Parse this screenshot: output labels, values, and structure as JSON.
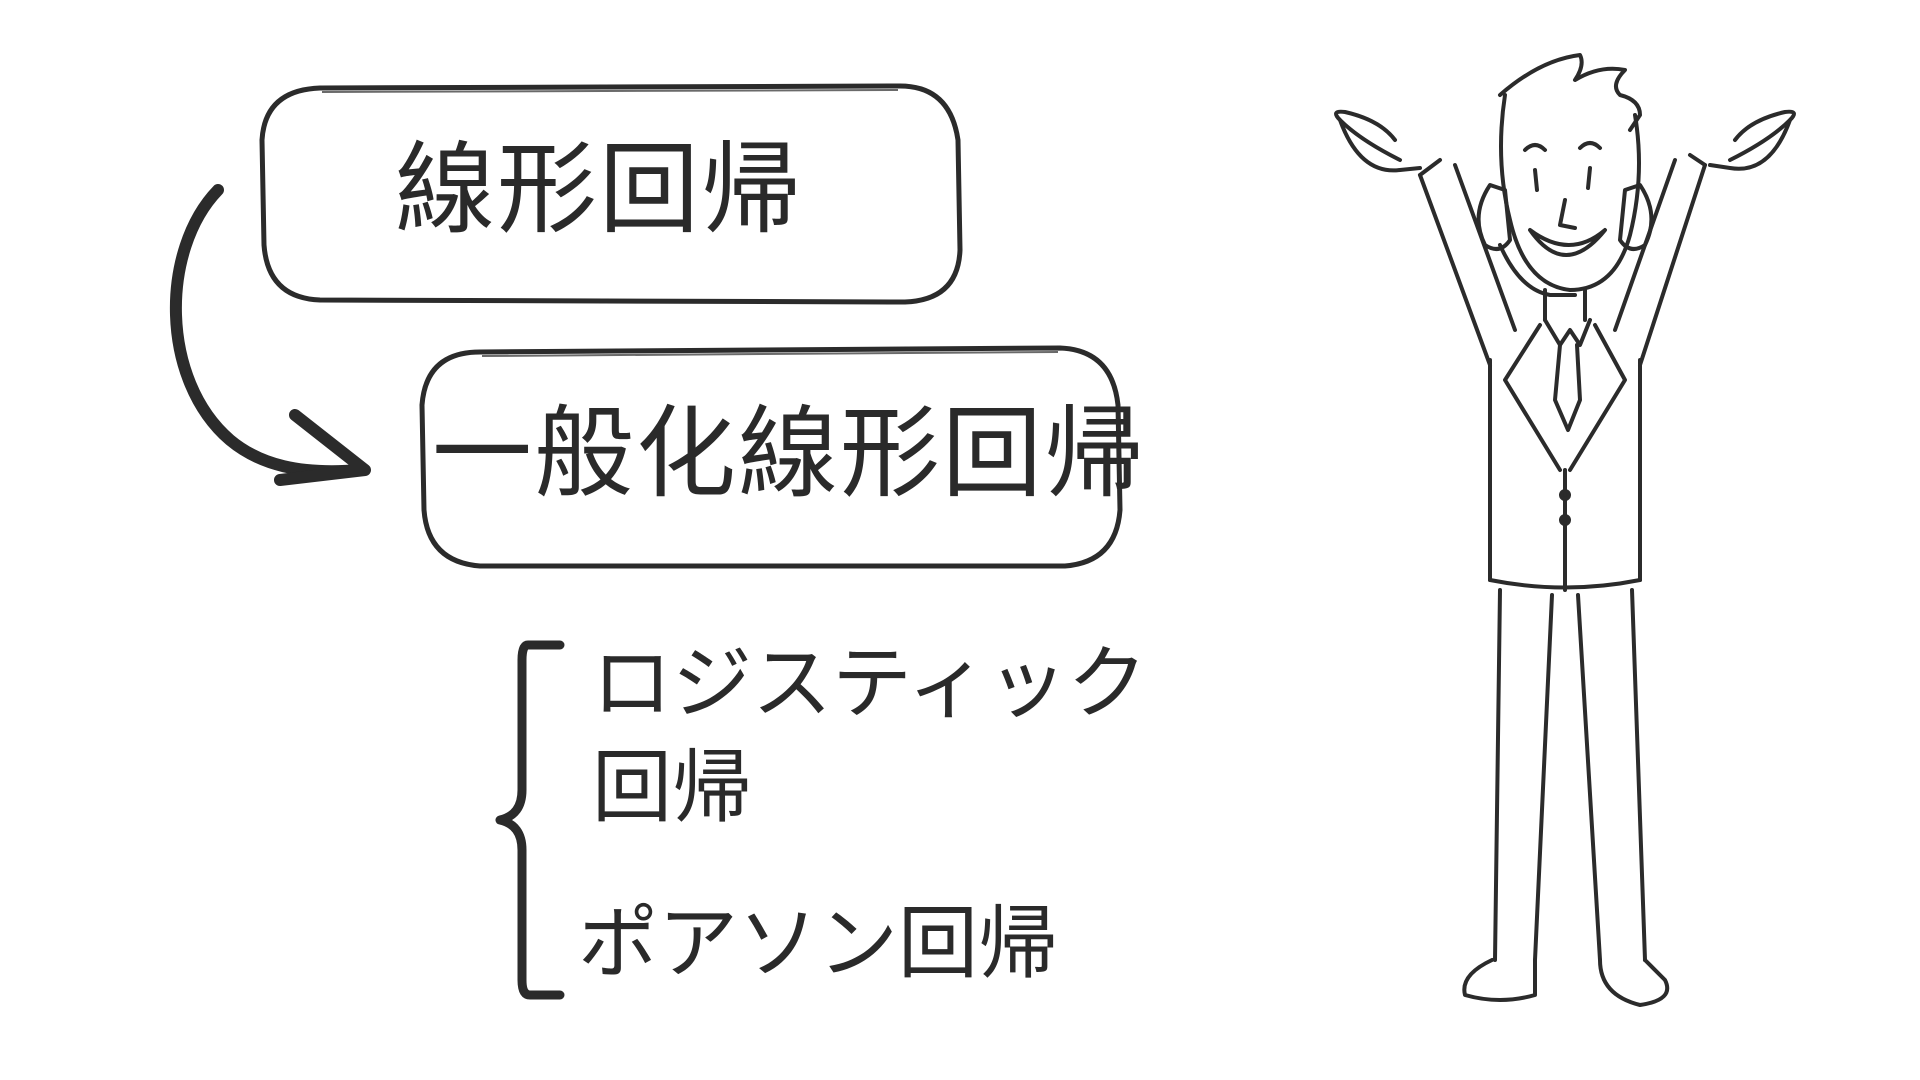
{
  "diagram": {
    "box_linear": {
      "label": "線形回帰"
    },
    "box_glm": {
      "label": "一般化線形回帰"
    },
    "examples": [
      {
        "line1": "ロジスティック",
        "line2": "回帰"
      },
      {
        "line1": "ポアソン回帰"
      }
    ]
  },
  "colors": {
    "ink": "#2b2b2b",
    "background": "#ffffff"
  },
  "icons": [
    "curved-arrow-icon",
    "left-brace-icon",
    "presenter-figure-icon"
  ]
}
